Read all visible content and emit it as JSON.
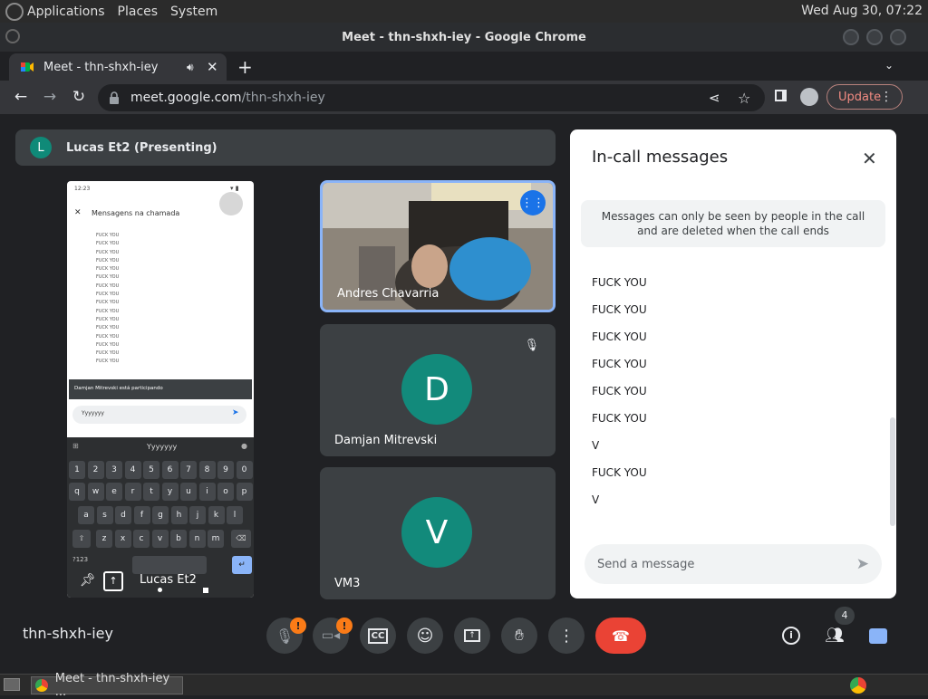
{
  "system": {
    "menu": [
      "Applications",
      "Places",
      "System"
    ],
    "clock": "Wed Aug 30, 07:22"
  },
  "window": {
    "title": "Meet - thn-shxh-iey - Google Chrome"
  },
  "tab": {
    "title": "Meet - thn-shxh-iey"
  },
  "omnibox": {
    "domain": "meet.google.com",
    "path": "/thn-shxh-iey"
  },
  "browser": {
    "update_label": "Update"
  },
  "presenter": {
    "initial": "L",
    "label": "Lucas Et2 (Presenting)"
  },
  "phone": {
    "time": "12:23",
    "header": "Mensagens na chamada",
    "messages": [
      "FUCK YOU",
      "FUCK YOU",
      "FUCK YOU",
      "FUCK YOU",
      "FUCK YOU",
      "FUCK YOU",
      "FUCK YOU",
      "FUCK YOU",
      "FUCK YOU",
      "FUCK YOU",
      "FUCK YOU",
      "FUCK YOU",
      "FUCK YOU",
      "FUCK YOU",
      "FUCK YOU",
      "FUCK YOU"
    ],
    "toast": "Damjan Mitrevski está participando",
    "input_value": "Yyyyyyy",
    "suggestion": "Yyyyyyy",
    "keys_row1": [
      "1",
      "2",
      "3",
      "4",
      "5",
      "6",
      "7",
      "8",
      "9",
      "0"
    ],
    "keys_row2": [
      "q",
      "w",
      "e",
      "r",
      "t",
      "y",
      "u",
      "i",
      "o",
      "p"
    ],
    "keys_row3": [
      "a",
      "s",
      "d",
      "f",
      "g",
      "h",
      "j",
      "k",
      "l"
    ],
    "keys_row4": [
      "z",
      "x",
      "c",
      "v",
      "b",
      "n",
      "m"
    ],
    "key_symbols": "?123",
    "presenter_name": "Lucas Et2"
  },
  "tiles": {
    "andres": "Andres Chavarria",
    "damjan": {
      "initial": "D",
      "name": "Damjan Mitrevski"
    },
    "vm3": {
      "initial": "V",
      "name": "VM3"
    }
  },
  "chat": {
    "title": "In-call messages",
    "notice": "Messages can only be seen by people in the call and are deleted when the call ends",
    "messages": [
      "FUCK YOU",
      "FUCK YOU",
      "FUCK YOU",
      "FUCK YOU",
      "FUCK YOU",
      "FUCK YOU",
      "V",
      "FUCK YOU",
      "V"
    ],
    "placeholder": "Send a message"
  },
  "meeting": {
    "code": "thn-shxh-iey",
    "people_count": "4",
    "mic_badge": "!",
    "cam_badge": "!"
  },
  "taskbar": {
    "item": "Meet - thn-shxh-iey ..."
  }
}
